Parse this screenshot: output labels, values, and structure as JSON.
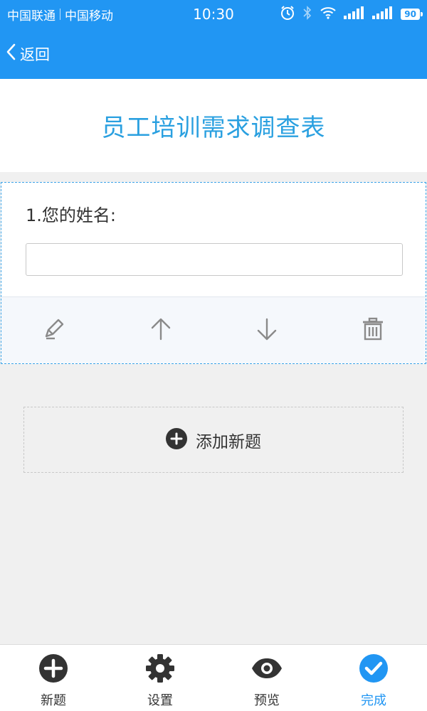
{
  "status_bar": {
    "carrier1": "中国联通",
    "carrier2": "中国移动",
    "time": "10:30",
    "battery": "90",
    "icons": [
      "alarm-icon",
      "bluetooth-icon",
      "wifi-icon",
      "signal-icon",
      "signal-icon",
      "battery-icon"
    ]
  },
  "nav": {
    "back_label": "返回"
  },
  "page": {
    "title": "员工培训需求调查表"
  },
  "question": {
    "label": "1.您的姓名:",
    "input_value": "",
    "tools": [
      "edit-icon",
      "move-up-icon",
      "move-down-icon",
      "delete-icon"
    ]
  },
  "add_question": {
    "label": "添加新题"
  },
  "tabbar": {
    "tabs": [
      {
        "label": "新题",
        "icon": "add-circle-icon",
        "active": false
      },
      {
        "label": "设置",
        "icon": "gear-icon",
        "active": false
      },
      {
        "label": "预览",
        "icon": "eye-icon",
        "active": false
      },
      {
        "label": "完成",
        "icon": "check-circle-icon",
        "active": true
      }
    ]
  },
  "colors": {
    "primary": "#2196f3",
    "title": "#2aa0e0",
    "icon_dark": "#333333",
    "tool_icon": "#8a8a8a"
  }
}
